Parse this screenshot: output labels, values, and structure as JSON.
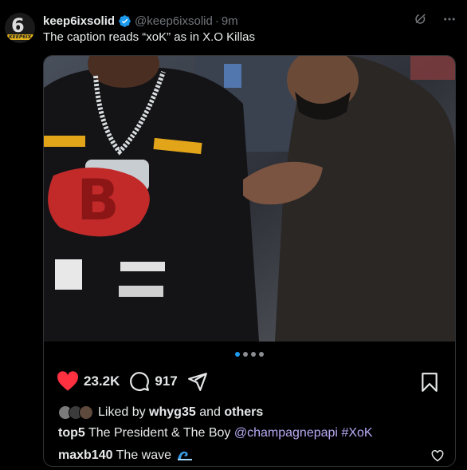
{
  "post": {
    "author_name": "keep6ixsolid",
    "handle": "@keep6ixsolid",
    "separator": "·",
    "time": "9m",
    "caption": "The caption reads “xoK” as in X.O Killas",
    "avatar_text": "6",
    "avatar_band_text": "KEEP6IX SOLID"
  },
  "media": {
    "slide_count": 4,
    "active_slide": 1
  },
  "actions": {
    "likes": "23.2K",
    "comments": "917",
    "liked": true
  },
  "liked_by": {
    "prefix": "Liked by",
    "user": "whyg35",
    "conj": "and",
    "others": "others"
  },
  "comments": [
    {
      "user": "top5",
      "text": "The President & The Boy",
      "mention": "@champagnepapi",
      "hashtag": "#XoK"
    },
    {
      "user": "maxb140",
      "text": "The wave",
      "emoji": "wave-emoji"
    }
  ],
  "colors": {
    "accent_blue": "#1d9bf0",
    "like_red": "#f91880",
    "mention_purple": "#b8a9f4",
    "background": "#000000"
  },
  "icons": [
    "verified-badge-icon",
    "grok-icon",
    "more-icon",
    "heart-icon",
    "comment-icon",
    "share-icon",
    "bookmark-icon",
    "heart-outline-icon"
  ]
}
